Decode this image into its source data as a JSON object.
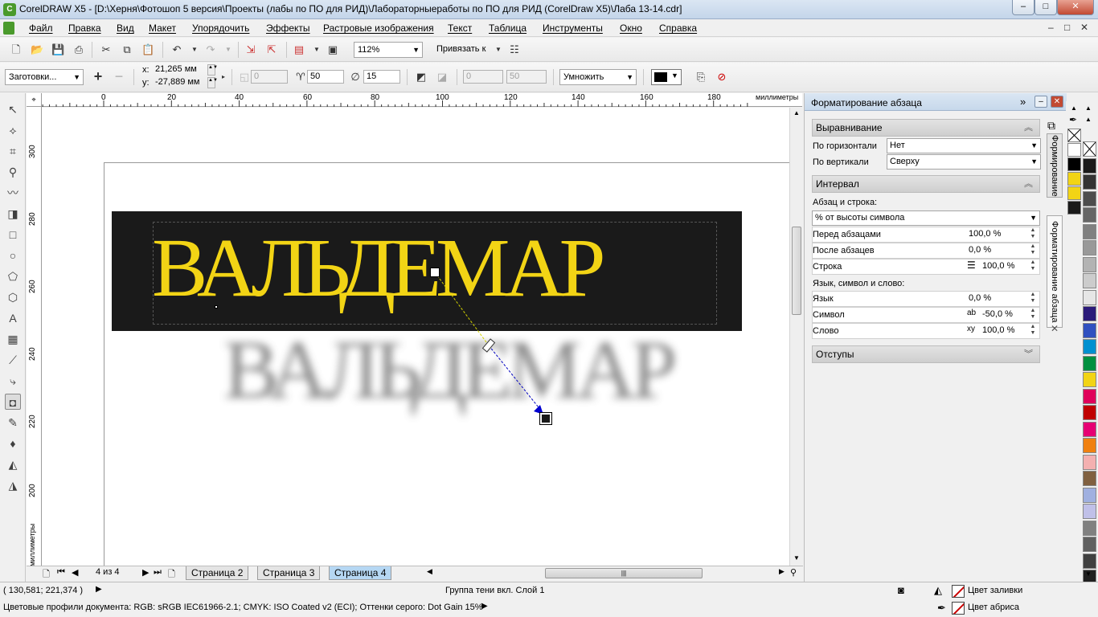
{
  "window": {
    "title": "CorelDRAW X5 - [D:\\Херня\\Фотошоп 5 версия\\Проекты (лабы по ПО для РИД)\\Лабораторныеработы по ПО для РИД (CorelDraw X5)\\Лаба 13-14.cdr]",
    "minimize": "–",
    "maximize": "□",
    "close": "✕"
  },
  "menu": {
    "items": [
      "Файл",
      "Правка",
      "Вид",
      "Макет",
      "Упорядочить",
      "Эффекты",
      "Растровые изображения",
      "Текст",
      "Таблица",
      "Инструменты",
      "Окно",
      "Справка"
    ],
    "doc_controls": [
      "–",
      "□",
      "✕"
    ]
  },
  "stdbar": {
    "zoom": "112%",
    "snap_label": "Привязать к"
  },
  "propbar": {
    "presets": "Заготовки...",
    "x_label": "x:",
    "x_value": "21,265 мм",
    "y_label": "y:",
    "y_value": "-27,889 мм",
    "f1": "0",
    "opacity": "50",
    "feather": "15",
    "f4": "0",
    "f5": "50",
    "blend_mode": "Умножить",
    "shadow_color": "#000000"
  },
  "toolbox": {
    "tools": [
      "pick-tool-icon",
      "shape-tool-icon",
      "crop-tool-icon",
      "zoom-tool-icon",
      "freehand-tool-icon",
      "smart-fill-icon",
      "rectangle-tool-icon",
      "ellipse-tool-icon",
      "polygon-tool-icon",
      "basic-shapes-icon",
      "text-tool-icon",
      "table-tool-icon",
      "dimension-tool-icon",
      "connector-tool-icon",
      "drop-shadow-tool-icon",
      "eyedropper-tool-icon",
      "outline-tool-icon",
      "fill-tool-icon",
      "interactive-fill-icon"
    ],
    "active_index": 14
  },
  "rulers": {
    "units": "миллиметры",
    "h_ticks": [
      "0",
      "20",
      "40",
      "60",
      "80",
      "100",
      "120",
      "140",
      "160",
      "180"
    ],
    "v_ticks": [
      "300",
      "280",
      "260",
      "240",
      "220",
      "200"
    ]
  },
  "canvas": {
    "main_text": "ВАЛЬДЕМАР",
    "shadow_text": "ВАЛЬДЕМАР",
    "text_color": "#f2d415",
    "rect_color": "#1a1a1a"
  },
  "pages": {
    "counter": "4 из 4",
    "tabs": [
      "Страница 2",
      "Страница 3",
      "Страница 4"
    ],
    "active": 2
  },
  "docker": {
    "title": "Форматирование абзаца",
    "align_section": "Выравнивание",
    "horiz_label": "По горизонтали",
    "horiz_value": "Нет",
    "vert_label": "По вертикали",
    "vert_value": "Сверху",
    "spacing_section": "Интервал",
    "para_line_label": "Абзац и строка:",
    "spacing_mode": "% от высоты символа",
    "before_label": "Перед абзацами",
    "before_value": "100,0 %",
    "after_label": "После абзацев",
    "after_value": "0,0 %",
    "line_label": "Строка",
    "line_value": "100,0 %",
    "lang_char_word_label": "Язык, символ и слово:",
    "lang_label": "Язык",
    "lang_value": "0,0 %",
    "char_label": "Символ",
    "char_value": "-50,0 %",
    "word_label": "Слово",
    "word_value": "100,0 %",
    "indent_section": "Отступы",
    "side_tab_1": "Формирование",
    "side_tab_2": "Форматирование абзаца"
  },
  "palette": {
    "colors": [
      "#ffffff",
      "#000000",
      "#f2d415",
      "#f2d415",
      "#1a1a1a"
    ],
    "colors2": [
      "#ffffff",
      "#1a1a1a",
      "#333333",
      "#4d4d4d",
      "#666666",
      "#808080",
      "#999999",
      "#b3b3b3",
      "#cccccc",
      "#e6e6e6",
      "#2b1a7a",
      "#3050c0",
      "#0090d0",
      "#009040",
      "#f2d415",
      "#e0005a",
      "#c00000",
      "#e60073",
      "#f08010",
      "#f4b0b0",
      "#806040",
      "#a0b0e0",
      "#c0c0e8",
      "#808080",
      "#606060",
      "#404040",
      "#202020"
    ]
  },
  "status": {
    "coords": "( 130,581; 221,374 )",
    "object_info": "Группа тени  вкл. Слой 1",
    "fill_label": "Цвет заливки",
    "outline_label": "Цвет абриса",
    "color_profiles": "Цветовые профили документа: RGB: sRGB IEC61966-2.1; CMYK: ISO Coated v2 (ECI); Оттенки серого: Dot Gain 15%"
  }
}
